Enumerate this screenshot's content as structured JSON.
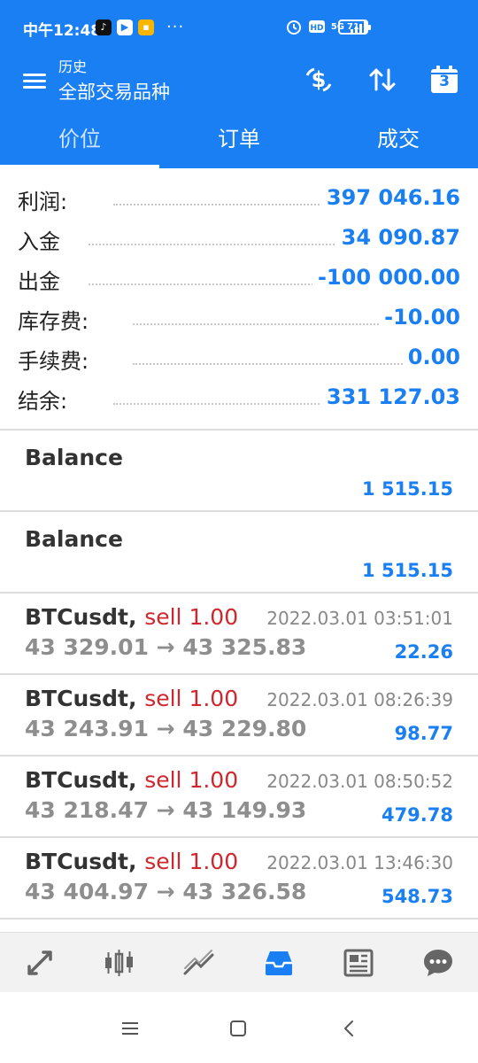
{
  "status_bar": {
    "time": "中午12:48",
    "dots": "···",
    "network": "5G",
    "battery": "71"
  },
  "toolbar": {
    "subtitle": "历史",
    "title": "全部交易品种",
    "calendar_day": "3"
  },
  "tabs": [
    {
      "label": "价位",
      "active": true
    },
    {
      "label": "订单",
      "active": false
    },
    {
      "label": "成交",
      "active": false
    }
  ],
  "summary": [
    {
      "label": "利润:",
      "value": "397 046.16"
    },
    {
      "label": "入金",
      "value": "34 090.87"
    },
    {
      "label": "出金",
      "value": "-100 000.00"
    },
    {
      "label": "库存费:",
      "value": "-10.00"
    },
    {
      "label": "手续费:",
      "value": "0.00"
    },
    {
      "label": "结余:",
      "value": "331 127.03"
    }
  ],
  "balances": [
    {
      "title": "Balance",
      "value": "1 515.15"
    },
    {
      "title": "Balance",
      "value": "1 515.15"
    }
  ],
  "deals": [
    {
      "symbol": "BTCusdt,",
      "side": "sell 1.00",
      "date": "2022.03.01 03:51:01",
      "prices": "43 329.01 → 43 325.83",
      "profit": "22.26"
    },
    {
      "symbol": "BTCusdt,",
      "side": "sell 1.00",
      "date": "2022.03.01 08:26:39",
      "prices": "43 243.91 → 43 229.80",
      "profit": "98.77"
    },
    {
      "symbol": "BTCusdt,",
      "side": "sell 1.00",
      "date": "2022.03.01 08:50:52",
      "prices": "43 218.47 → 43 149.93",
      "profit": "479.78"
    },
    {
      "symbol": "BTCusdt,",
      "side": "sell 1.00",
      "date": "2022.03.01 13:46:30",
      "prices": "43 404.97 → 43 326.58",
      "profit": "548.73"
    }
  ],
  "bottom_nav": [
    {
      "icon": "quotes-arrows-icon",
      "active": false
    },
    {
      "icon": "candlestick-chart-icon",
      "active": false
    },
    {
      "icon": "trend-chart-icon",
      "active": false
    },
    {
      "icon": "history-inbox-icon",
      "active": true
    },
    {
      "icon": "news-icon",
      "active": false
    },
    {
      "icon": "chat-bubble-icon",
      "active": false
    }
  ],
  "colors": {
    "primary": "#1a7ff2",
    "profit_text": "#1a7ff2",
    "sell_text": "#d0262d",
    "muted_text": "#8e8e8e"
  }
}
